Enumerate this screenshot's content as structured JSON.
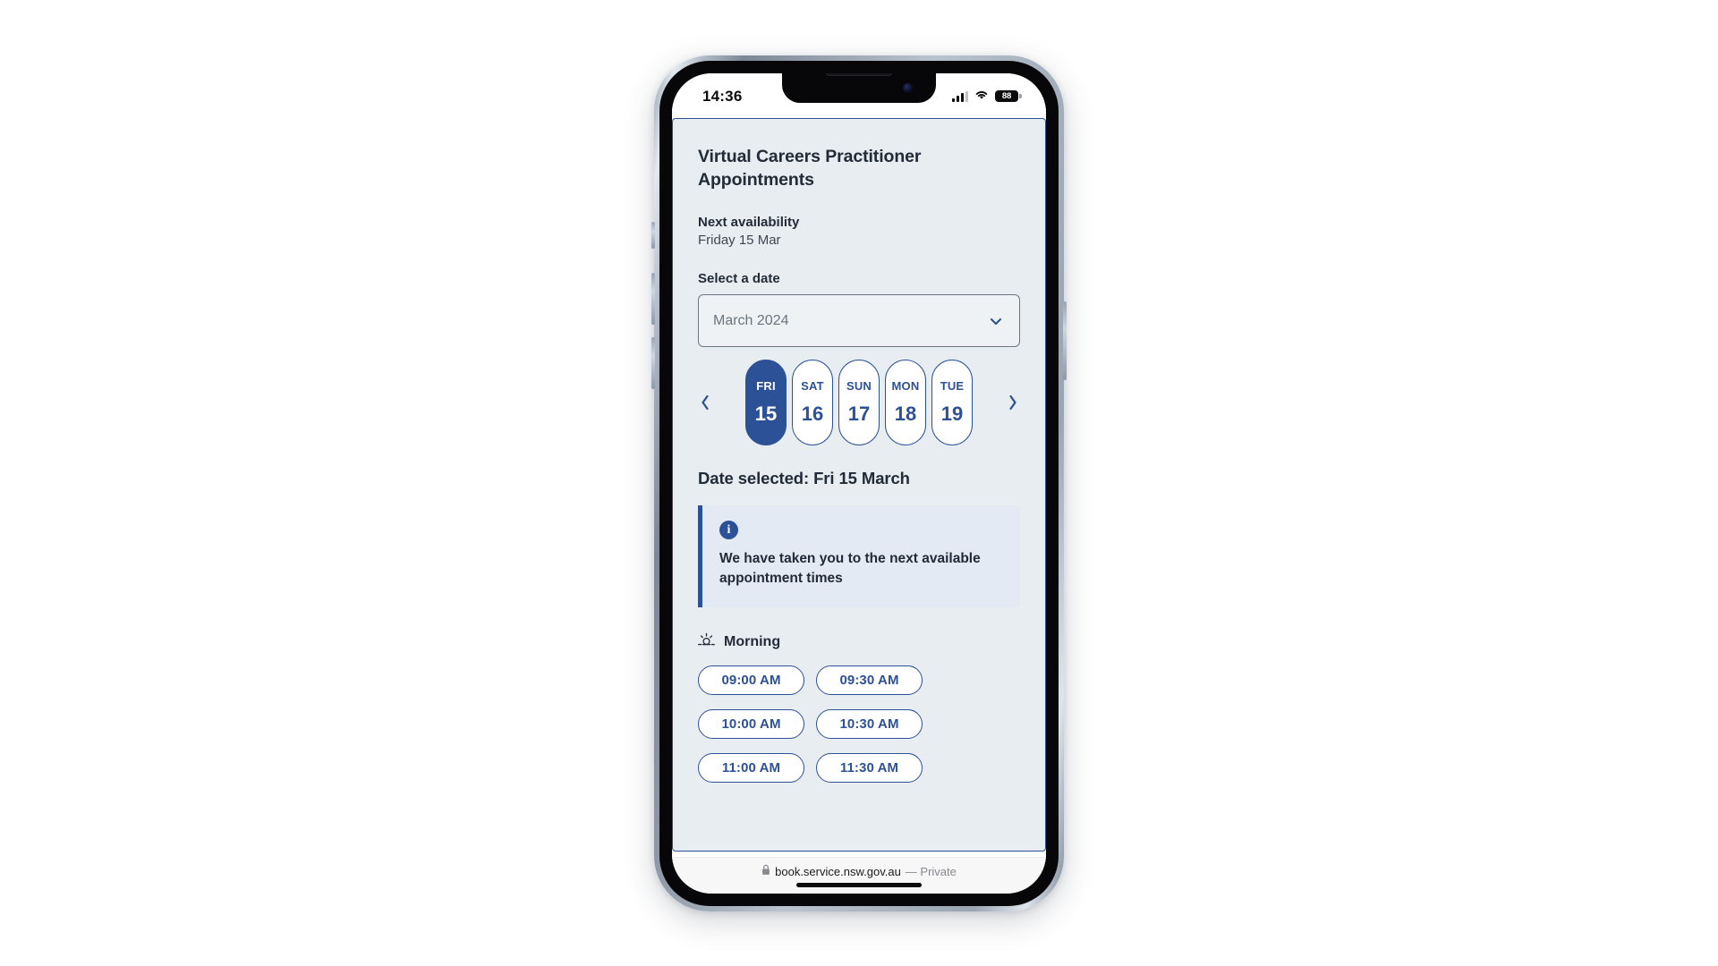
{
  "status_bar": {
    "time": "14:36",
    "battery_percent": "88",
    "signal_icon": "cellular-signal-icon",
    "wifi_icon": "wifi-icon",
    "battery_icon": "battery-icon"
  },
  "page": {
    "title": "Virtual Careers Practitioner Appointments",
    "next_availability_label": "Next availability",
    "next_availability_value": "Friday 15 Mar",
    "select_date_label": "Select a date",
    "date_selected_heading": "Date selected: Fri 15 March"
  },
  "month_select": {
    "value": "March 2024",
    "chevron_icon": "chevron-down-icon"
  },
  "date_strip": {
    "prev_icon": "chevron-left-icon",
    "next_icon": "chevron-right-icon",
    "days": [
      {
        "dow": "FRI",
        "dom": "15",
        "selected": true
      },
      {
        "dow": "SAT",
        "dom": "16",
        "selected": false
      },
      {
        "dow": "SUN",
        "dom": "17",
        "selected": false
      },
      {
        "dow": "MON",
        "dom": "18",
        "selected": false
      },
      {
        "dow": "TUE",
        "dom": "19",
        "selected": false
      }
    ]
  },
  "info_callout": {
    "icon": "info-circle-icon",
    "icon_glyph": "i",
    "text": "We have taken you to the next available appointment times"
  },
  "morning": {
    "icon": "sunrise-icon",
    "label": "Morning",
    "slots": [
      [
        "09:00 AM",
        "09:30 AM"
      ],
      [
        "10:00 AM",
        "10:30 AM"
      ],
      [
        "11:00 AM",
        "11:30 AM"
      ]
    ]
  },
  "browser_bar": {
    "lock_icon": "lock-icon",
    "url": "book.service.nsw.gov.au",
    "private_label": "— Private"
  },
  "colors": {
    "brand_blue": "#2d5196",
    "card_bg": "#e8edf1",
    "callout_bg": "#e4eaf3",
    "text_dark": "#222b38",
    "muted_text": "#6b747f"
  }
}
